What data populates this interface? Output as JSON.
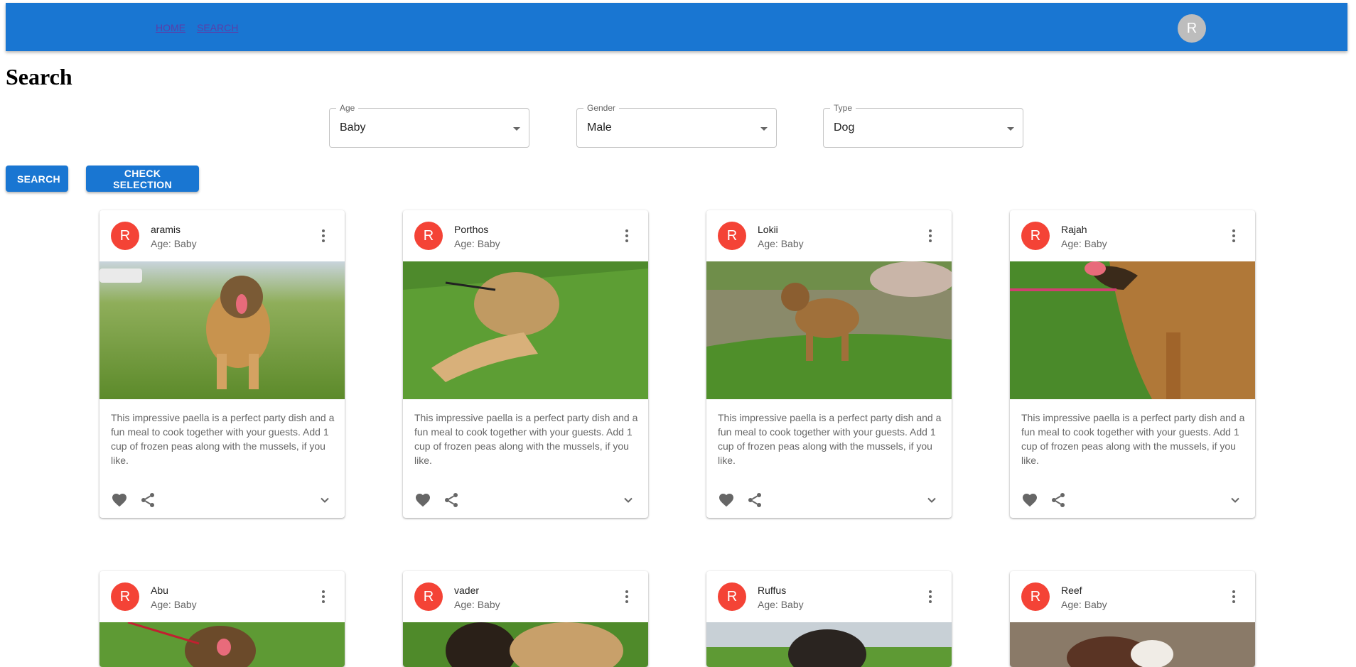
{
  "nav": {
    "home": "HOME",
    "search": "SEARCH",
    "avatar_letter": "R"
  },
  "page_title": "Search",
  "filters": {
    "age": {
      "label": "Age",
      "value": "Baby"
    },
    "gender": {
      "label": "Gender",
      "value": "Male"
    },
    "type": {
      "label": "Type",
      "value": "Dog"
    }
  },
  "buttons": {
    "search": "SEARCH",
    "check": "CHECK SELECTION"
  },
  "colors": {
    "primary": "#1976d2",
    "avatar_red": "#f44336",
    "avatar_grey": "#bdbdbd"
  },
  "cards": [
    {
      "avatar": "R",
      "name": "aramis",
      "age": "Age: Baby",
      "text": "This impressive paella is a perfect party dish and a fun meal to cook together with your guests. Add 1 cup of frozen peas along with the mussels, if you like."
    },
    {
      "avatar": "R",
      "name": "Porthos",
      "age": "Age: Baby",
      "text": "This impressive paella is a perfect party dish and a fun meal to cook together with your guests. Add 1 cup of frozen peas along with the mussels, if you like."
    },
    {
      "avatar": "R",
      "name": "Lokii",
      "age": "Age: Baby",
      "text": "This impressive paella is a perfect party dish and a fun meal to cook together with your guests. Add 1 cup of frozen peas along with the mussels, if you like."
    },
    {
      "avatar": "R",
      "name": "Rajah",
      "age": "Age: Baby",
      "text": "This impressive paella is a perfect party dish and a fun meal to cook together with your guests. Add 1 cup of frozen peas along with the mussels, if you like."
    },
    {
      "avatar": "R",
      "name": "Abu",
      "age": "Age: Baby"
    },
    {
      "avatar": "R",
      "name": "vader",
      "age": "Age: Baby"
    },
    {
      "avatar": "R",
      "name": "Ruffus",
      "age": "Age: Baby"
    },
    {
      "avatar": "R",
      "name": "Reef",
      "age": "Age: Baby"
    }
  ],
  "icons": {
    "more": "more-vert-icon",
    "favorite": "heart-icon",
    "share": "share-icon",
    "expand": "chevron-down-icon"
  }
}
